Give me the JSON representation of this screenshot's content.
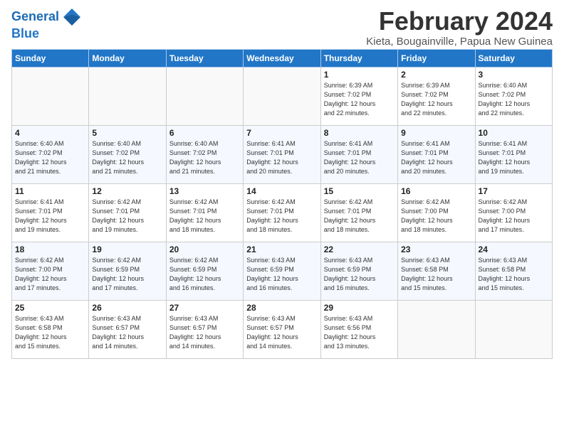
{
  "header": {
    "logo_line1": "General",
    "logo_line2": "Blue",
    "title": "February 2024",
    "location": "Kieta, Bougainville, Papua New Guinea"
  },
  "days_of_week": [
    "Sunday",
    "Monday",
    "Tuesday",
    "Wednesday",
    "Thursday",
    "Friday",
    "Saturday"
  ],
  "weeks": [
    [
      {
        "day": "",
        "info": ""
      },
      {
        "day": "",
        "info": ""
      },
      {
        "day": "",
        "info": ""
      },
      {
        "day": "",
        "info": ""
      },
      {
        "day": "1",
        "info": "Sunrise: 6:39 AM\nSunset: 7:02 PM\nDaylight: 12 hours\nand 22 minutes."
      },
      {
        "day": "2",
        "info": "Sunrise: 6:39 AM\nSunset: 7:02 PM\nDaylight: 12 hours\nand 22 minutes."
      },
      {
        "day": "3",
        "info": "Sunrise: 6:40 AM\nSunset: 7:02 PM\nDaylight: 12 hours\nand 22 minutes."
      }
    ],
    [
      {
        "day": "4",
        "info": "Sunrise: 6:40 AM\nSunset: 7:02 PM\nDaylight: 12 hours\nand 21 minutes."
      },
      {
        "day": "5",
        "info": "Sunrise: 6:40 AM\nSunset: 7:02 PM\nDaylight: 12 hours\nand 21 minutes."
      },
      {
        "day": "6",
        "info": "Sunrise: 6:40 AM\nSunset: 7:02 PM\nDaylight: 12 hours\nand 21 minutes."
      },
      {
        "day": "7",
        "info": "Sunrise: 6:41 AM\nSunset: 7:01 PM\nDaylight: 12 hours\nand 20 minutes."
      },
      {
        "day": "8",
        "info": "Sunrise: 6:41 AM\nSunset: 7:01 PM\nDaylight: 12 hours\nand 20 minutes."
      },
      {
        "day": "9",
        "info": "Sunrise: 6:41 AM\nSunset: 7:01 PM\nDaylight: 12 hours\nand 20 minutes."
      },
      {
        "day": "10",
        "info": "Sunrise: 6:41 AM\nSunset: 7:01 PM\nDaylight: 12 hours\nand 19 minutes."
      }
    ],
    [
      {
        "day": "11",
        "info": "Sunrise: 6:41 AM\nSunset: 7:01 PM\nDaylight: 12 hours\nand 19 minutes."
      },
      {
        "day": "12",
        "info": "Sunrise: 6:42 AM\nSunset: 7:01 PM\nDaylight: 12 hours\nand 19 minutes."
      },
      {
        "day": "13",
        "info": "Sunrise: 6:42 AM\nSunset: 7:01 PM\nDaylight: 12 hours\nand 18 minutes."
      },
      {
        "day": "14",
        "info": "Sunrise: 6:42 AM\nSunset: 7:01 PM\nDaylight: 12 hours\nand 18 minutes."
      },
      {
        "day": "15",
        "info": "Sunrise: 6:42 AM\nSunset: 7:01 PM\nDaylight: 12 hours\nand 18 minutes."
      },
      {
        "day": "16",
        "info": "Sunrise: 6:42 AM\nSunset: 7:00 PM\nDaylight: 12 hours\nand 18 minutes."
      },
      {
        "day": "17",
        "info": "Sunrise: 6:42 AM\nSunset: 7:00 PM\nDaylight: 12 hours\nand 17 minutes."
      }
    ],
    [
      {
        "day": "18",
        "info": "Sunrise: 6:42 AM\nSunset: 7:00 PM\nDaylight: 12 hours\nand 17 minutes."
      },
      {
        "day": "19",
        "info": "Sunrise: 6:42 AM\nSunset: 6:59 PM\nDaylight: 12 hours\nand 17 minutes."
      },
      {
        "day": "20",
        "info": "Sunrise: 6:42 AM\nSunset: 6:59 PM\nDaylight: 12 hours\nand 16 minutes."
      },
      {
        "day": "21",
        "info": "Sunrise: 6:43 AM\nSunset: 6:59 PM\nDaylight: 12 hours\nand 16 minutes."
      },
      {
        "day": "22",
        "info": "Sunrise: 6:43 AM\nSunset: 6:59 PM\nDaylight: 12 hours\nand 16 minutes."
      },
      {
        "day": "23",
        "info": "Sunrise: 6:43 AM\nSunset: 6:58 PM\nDaylight: 12 hours\nand 15 minutes."
      },
      {
        "day": "24",
        "info": "Sunrise: 6:43 AM\nSunset: 6:58 PM\nDaylight: 12 hours\nand 15 minutes."
      }
    ],
    [
      {
        "day": "25",
        "info": "Sunrise: 6:43 AM\nSunset: 6:58 PM\nDaylight: 12 hours\nand 15 minutes."
      },
      {
        "day": "26",
        "info": "Sunrise: 6:43 AM\nSunset: 6:57 PM\nDaylight: 12 hours\nand 14 minutes."
      },
      {
        "day": "27",
        "info": "Sunrise: 6:43 AM\nSunset: 6:57 PM\nDaylight: 12 hours\nand 14 minutes."
      },
      {
        "day": "28",
        "info": "Sunrise: 6:43 AM\nSunset: 6:57 PM\nDaylight: 12 hours\nand 14 minutes."
      },
      {
        "day": "29",
        "info": "Sunrise: 6:43 AM\nSunset: 6:56 PM\nDaylight: 12 hours\nand 13 minutes."
      },
      {
        "day": "",
        "info": ""
      },
      {
        "day": "",
        "info": ""
      }
    ]
  ]
}
